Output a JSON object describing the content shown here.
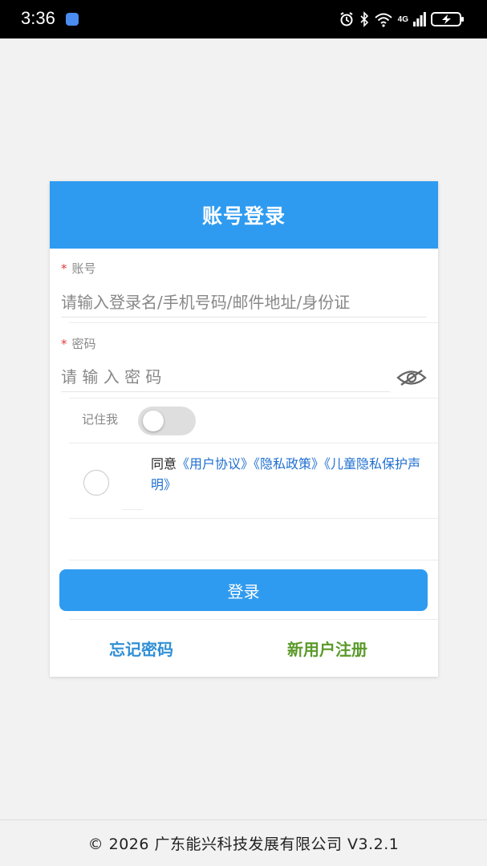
{
  "status_bar": {
    "time": "3:36",
    "network": "4G",
    "icons": [
      "usb-icon",
      "alarm-icon",
      "bluetooth-icon",
      "wifi-icon",
      "signal-icon",
      "battery-charging-icon"
    ]
  },
  "login": {
    "title": "账号登录",
    "account": {
      "required_mark": "*",
      "label": "账号",
      "placeholder": "请输入登录名/手机号码/邮件地址/身份证"
    },
    "password": {
      "required_mark": "*",
      "label": "密码",
      "placeholder": "请 输 入 密 码"
    },
    "remember_label": "记住我",
    "remember_on": false,
    "agreement": {
      "checked": false,
      "prefix": "同意",
      "user_agreement": "《用户协议》",
      "privacy_policy": "《隐私政策》",
      "child_privacy": "《儿童隐私保护声明》"
    },
    "login_button": "登录",
    "forgot_password": "忘记密码",
    "register": "新用户注册"
  },
  "footer": {
    "text": "© 2026 广东能兴科技发展有限公司 V3.2.1"
  },
  "colors": {
    "primary": "#2f9bf0",
    "link": "#1f6fd1",
    "register": "#5a9a2a",
    "required": "#e23c3c"
  }
}
